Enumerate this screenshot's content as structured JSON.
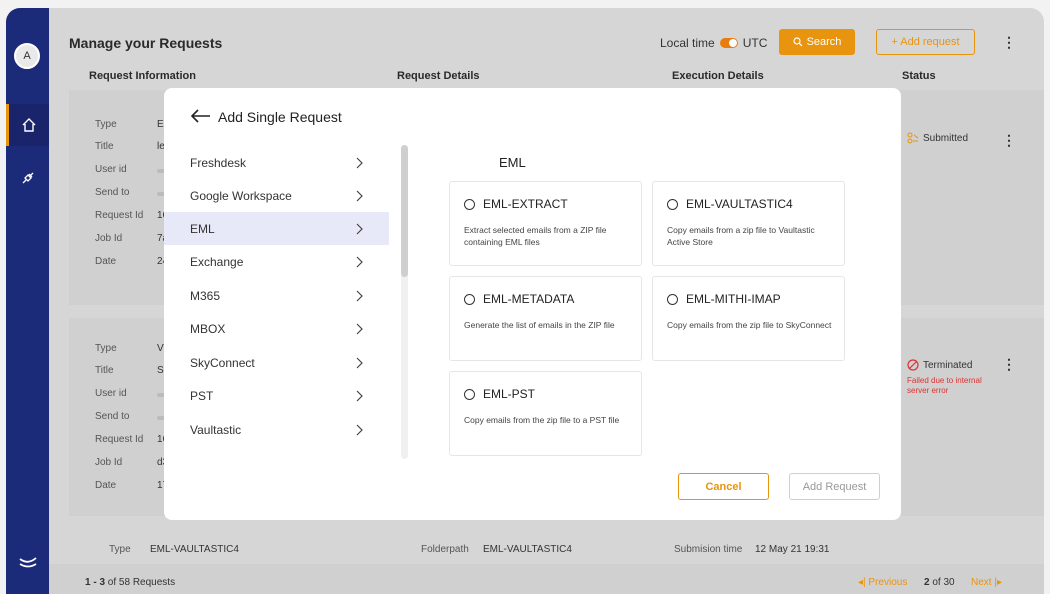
{
  "user": {
    "avatar_letter": "A"
  },
  "header": {
    "title": "Manage your Requests",
    "local_time_label": "Local time",
    "utc_label": "UTC",
    "search_label": "Search",
    "add_request_label": "+ Add request"
  },
  "columns": [
    "Request Information",
    "Request Details",
    "Execution Details",
    "Status"
  ],
  "cards": [
    {
      "labels": [
        "Type",
        "Title",
        "User id",
        "Send to",
        "Request Id",
        "Job Id",
        "Date"
      ],
      "values": [
        "EM",
        "leg",
        "",
        "",
        "162",
        "7a5",
        "24"
      ],
      "status": "Submitted"
    },
    {
      "labels": [
        "Type",
        "Title",
        "User id",
        "Send to",
        "Request Id",
        "Job Id",
        "Date"
      ],
      "values": [
        "VV",
        "S3",
        "",
        "",
        "168",
        "d34",
        "17"
      ],
      "status": "Terminated",
      "error": "Failed due to internal server error"
    }
  ],
  "third_row": {
    "type_label": "Type",
    "type_value": "EML-VAULTASTIC4",
    "folderpath_label": "Folderpath",
    "folderpath_value": "EML-VAULTASTIC4",
    "submission_label": "Submision time",
    "submission_value": "12 May 21 19:31"
  },
  "footer": {
    "range": "1 - 3",
    "of_text": "of 58 Requests",
    "previous": "Previous",
    "page": "2",
    "page_of": "of 30",
    "next": "Next"
  },
  "modal": {
    "title": "Add Single Request",
    "categories": [
      "Freshdesk",
      "Google Workspace",
      "EML",
      "Exchange",
      "M365",
      "MBOX",
      "SkyConnect",
      "PST",
      "Vaultastic"
    ],
    "selected_category": "EML",
    "section_title": "EML",
    "options": [
      {
        "name": "EML-EXTRACT",
        "desc": "Extract selected emails from a ZIP file containing EML files"
      },
      {
        "name": "EML-VAULTASTIC4",
        "desc": "Copy emails from a zip file to Vaultastic Active Store"
      },
      {
        "name": "EML-METADATA",
        "desc": "Generate the list of emails in the ZIP file"
      },
      {
        "name": "EML-MITHI-IMAP",
        "desc": "Copy emails from the zip file to SkyConnect"
      },
      {
        "name": "EML-PST",
        "desc": "Copy emails from the zip file to a PST file"
      }
    ],
    "cancel_label": "Cancel",
    "add_label": "Add Request"
  },
  "colors": {
    "accent": "#e8940e",
    "sidebar": "#1c2a7a",
    "selected": "#e8e9f8",
    "error": "#dd3333"
  }
}
